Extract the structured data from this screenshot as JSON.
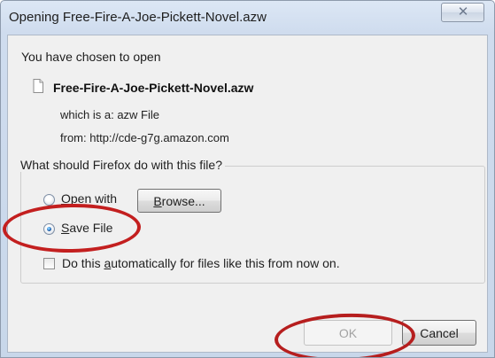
{
  "dialog": {
    "title": "Opening Free-Fire-A-Joe-Pickett-Novel.azw",
    "close_symbol": "✕"
  },
  "content": {
    "intro": "You have chosen to open",
    "file_name": "Free-Fire-A-Joe-Pickett-Novel.azw",
    "type_prefix": "which is a:",
    "file_type": "azw File",
    "source_prefix": "from:",
    "source_url": "http://cde-g7g.amazon.com"
  },
  "options": {
    "group_title": "What should Firefox do with this file?",
    "open_with_prefix": "O",
    "open_with_suffix": "pen with",
    "browse_prefix": "B",
    "browse_suffix": "rowse...",
    "save_prefix": "S",
    "save_suffix": "ave File",
    "auto_before": "Do this ",
    "auto_accel": "a",
    "auto_after": "utomatically for files like this from now on."
  },
  "buttons": {
    "ok": "OK",
    "cancel": "Cancel"
  },
  "state": {
    "selected_option": "Save File",
    "auto_checked": false,
    "ok_enabled": false
  },
  "colors": {
    "annotation": "#c31f1f",
    "window_border": "#8d9aac",
    "panel_bg": "#f0f0f0"
  },
  "icons": {
    "close": "close-icon",
    "file": "file-icon",
    "radio": "radio-icon",
    "checkbox": "checkbox-icon"
  }
}
